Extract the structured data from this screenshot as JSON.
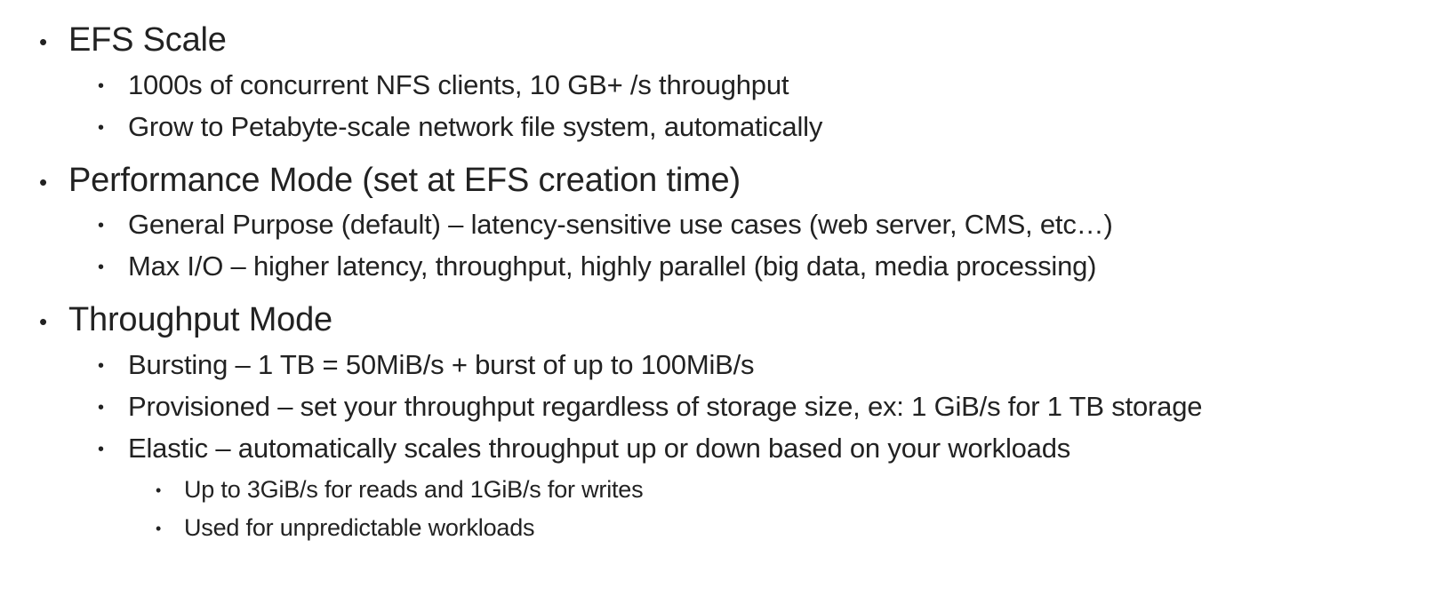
{
  "bullet_glyph": "•",
  "sections": [
    {
      "heading": "EFS Scale",
      "items": [
        {
          "term": "",
          "text": "1000s of concurrent NFS clients, 10 GB+ /s throughput"
        },
        {
          "term": "",
          "text": "Grow to Petabyte-scale network file system, automatically"
        }
      ]
    },
    {
      "heading": "Performance Mode (set at EFS creation time)",
      "items": [
        {
          "term": "General Purpose (default)",
          "text": " – latency-sensitive use cases (web server, CMS, etc…)"
        },
        {
          "term": "Max I/O",
          "text": " – higher latency, throughput, highly parallel (big data, media processing)"
        }
      ]
    },
    {
      "heading": "Throughput Mode",
      "items": [
        {
          "term": "Bursting",
          "text": " – 1 TB = 50MiB/s + burst of up to 100MiB/s"
        },
        {
          "term": "Provisioned",
          "text": " – set your throughput regardless of storage size, ex: 1 GiB/s for 1 TB storage"
        },
        {
          "term": "Elastic",
          "text": " – automatically scales throughput up or down based on your workloads",
          "subitems": [
            "Up to 3GiB/s for reads and 1GiB/s for writes",
            "Used for unpredictable workloads"
          ]
        }
      ]
    }
  ]
}
